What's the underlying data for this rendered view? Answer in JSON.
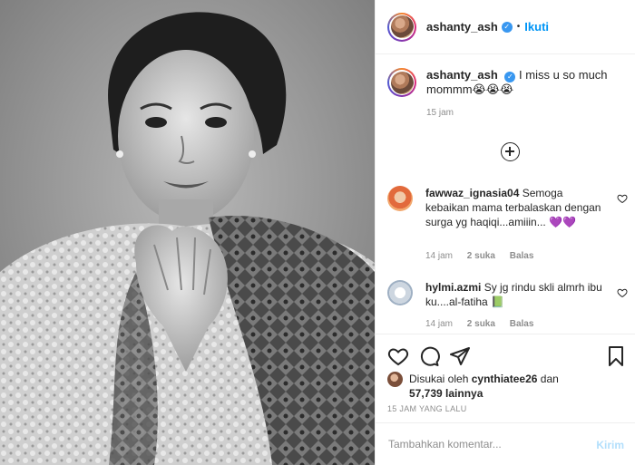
{
  "post": {
    "author": "ashanty_ash",
    "follow_label": "Ikuti",
    "dot": "•",
    "verified_icon": "verified-badge-icon"
  },
  "caption": {
    "username": "ashanty_ash",
    "text": "I miss u so much mommm😭😭😭",
    "time": "15 jam"
  },
  "comments": [
    {
      "username": "fawwaz_ignasia04",
      "text": "Semoga kebaikan mama terbalaskan dengan surga yg haqiqi...amiiin... 💜💜",
      "time": "14 jam",
      "likes": "2 suka",
      "reply": "Balas"
    },
    {
      "username": "hylmi.azmi",
      "text": "Sy jg rindu skli almrh ibu ku....al-fatiha 📗",
      "time": "14 jam",
      "likes": "2 suka",
      "reply": "Balas"
    }
  ],
  "likes": {
    "prefix": "Disukai oleh",
    "user": "cynthiatee26",
    "conj": "dan",
    "count": "57,739 lainnya"
  },
  "posted_ago": "15 JAM YANG LALU",
  "composer": {
    "placeholder": "Tambahkan komentar...",
    "send_label": "Kirim"
  },
  "colors": {
    "accent": "#0095f6",
    "muted": "#8e8e8e",
    "send_disabled": "#b2dffc"
  }
}
